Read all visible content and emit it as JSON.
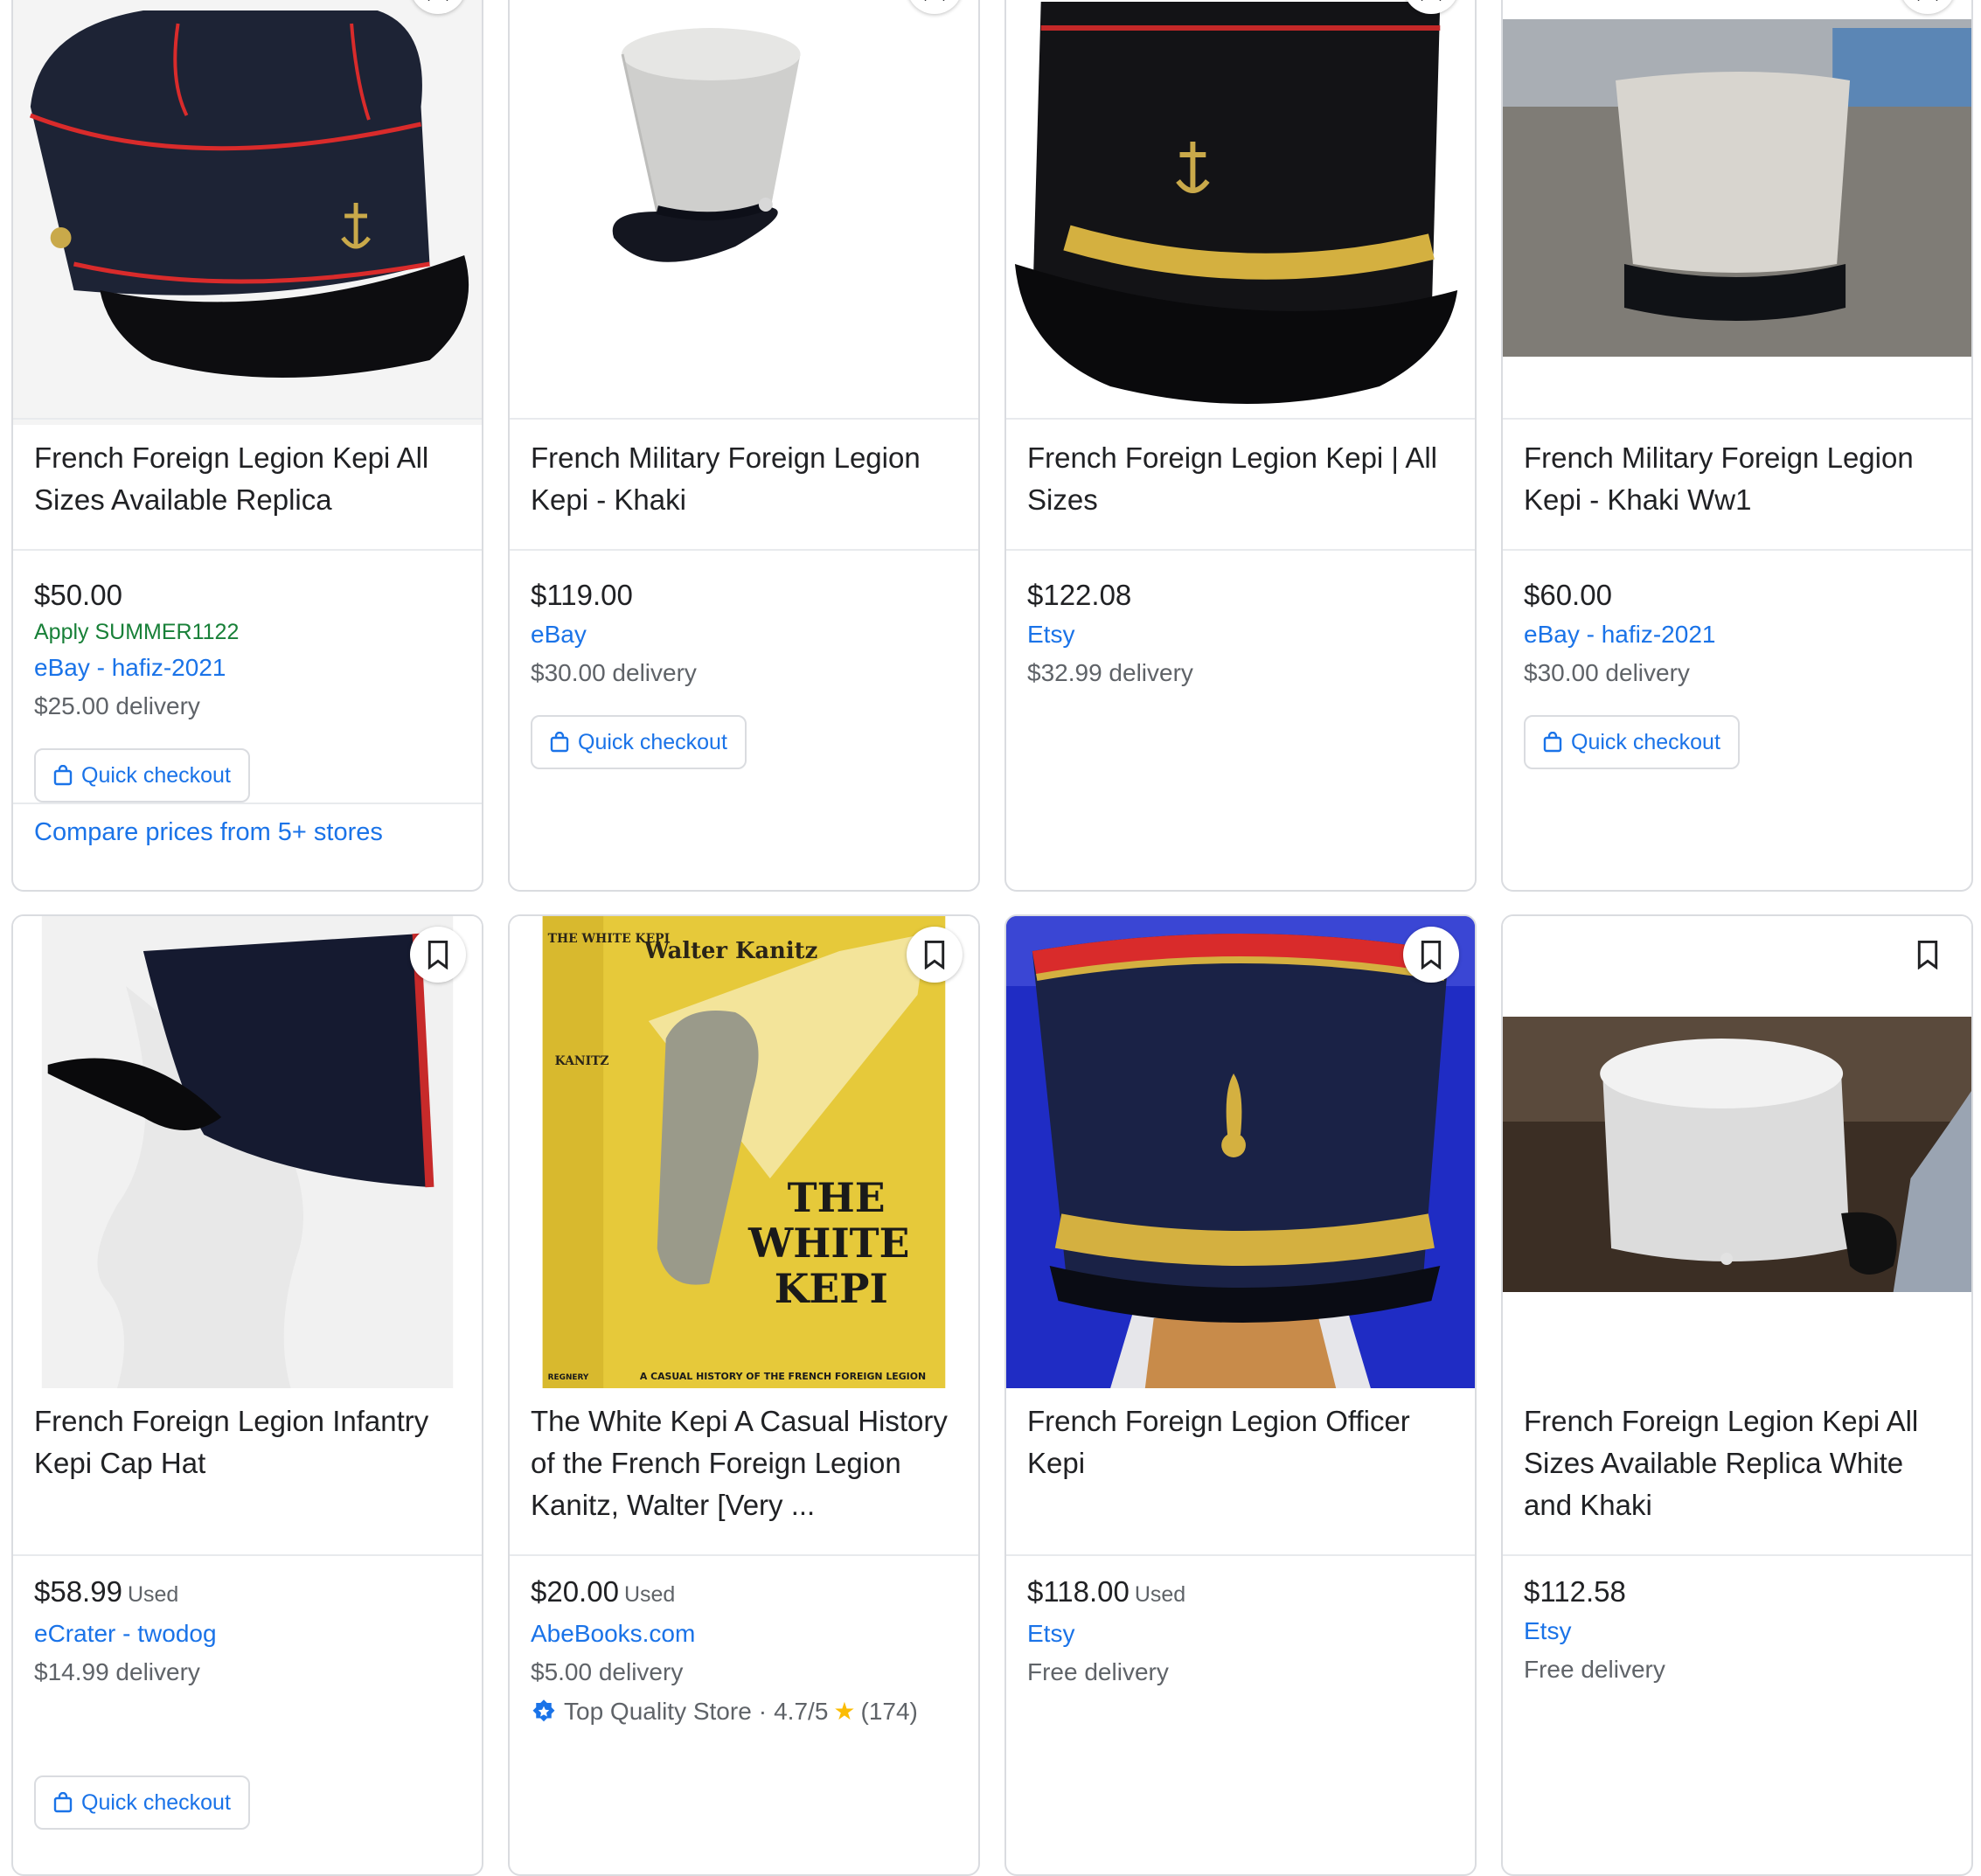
{
  "products": [
    {
      "title": "French Foreign Legion Kepi All Sizes Available Replica",
      "price": "$50.00",
      "promo": "Apply SUMMER1122",
      "seller": "eBay - hafiz-2021",
      "delivery": "$25.00 delivery",
      "quick_checkout": "Quick checkout",
      "compare": "Compare prices from 5+ stores"
    },
    {
      "title": "French Military Foreign Legion Kepi - Khaki",
      "price": "$119.00",
      "seller": "eBay",
      "delivery": "$30.00 delivery",
      "quick_checkout": "Quick checkout"
    },
    {
      "title": "French Foreign Legion Kepi | All Sizes",
      "price": "$122.08",
      "seller": "Etsy",
      "delivery": "$32.99 delivery"
    },
    {
      "title": "French Military Foreign Legion Kepi - Khaki Ww1",
      "price": "$60.00",
      "seller": "eBay - hafiz-2021",
      "delivery": "$30.00 delivery",
      "quick_checkout": "Quick checkout"
    },
    {
      "title": "French Foreign Legion Infantry Kepi Cap Hat",
      "price": "$58.99",
      "condition": "Used",
      "seller": "eCrater - twodog",
      "delivery": "$14.99 delivery",
      "quick_checkout": "Quick checkout"
    },
    {
      "title": "The White Kepi A Casual History of the French Foreign Legion Kanitz, Walter [Very ...",
      "price": "$20.00",
      "condition": "Used",
      "seller": "AbeBooks.com",
      "delivery": "$5.00 delivery",
      "store_badge": "Top Quality Store",
      "rating": "4.7/5",
      "reviews": "(174)",
      "book_cover": {
        "author": "Walter Kanitz",
        "title_line1": "THE",
        "title_line2": "WHITE",
        "title_line3": "KEPI",
        "subtitle": "A CASUAL HISTORY OF THE FRENCH FOREIGN LEGION",
        "spine_title": "THE WHITE KEPI",
        "spine_author": "KANITZ",
        "publisher": "REGNERY"
      }
    },
    {
      "title": "French Foreign Legion Officer Kepi",
      "price": "$118.00",
      "condition": "Used",
      "seller": "Etsy",
      "delivery": "Free delivery"
    },
    {
      "title": "French Foreign Legion Kepi All Sizes Available Replica White and Khaki",
      "price": "$112.58",
      "seller": "Etsy",
      "delivery": "Free delivery"
    }
  ],
  "icons": {
    "bookmark": "bookmark-icon",
    "bag": "shopping-bag-icon",
    "badge": "verified-badge-icon",
    "star": "star-icon"
  },
  "colors": {
    "link": "#1a73e8",
    "promo": "#188038",
    "muted": "#5f6368",
    "text": "#202124",
    "star": "#fbbc04"
  }
}
